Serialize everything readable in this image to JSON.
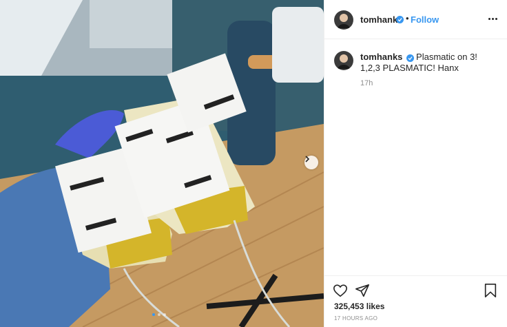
{
  "post": {
    "photo": {
      "image_icon": "photo-of-plasma-bags",
      "carousel_next_icon": "chevron-right-icon",
      "carousel_dots": 3,
      "carousel_active_index": 0
    },
    "header": {
      "username": "tomhanks",
      "verified_icon": "verified-badge-icon",
      "separator": "•",
      "follow_label": "Follow",
      "more_icon": "more-options-icon"
    },
    "caption": {
      "username": "tomhanks",
      "text": "Plasmatic on 3! 1,2,3 PLASMATIC! Hanx",
      "time": "17h"
    },
    "actions": {
      "like_icon": "heart-icon",
      "share_icon": "share-icon",
      "save_icon": "bookmark-icon",
      "likes_count": "325,453",
      "likes_label": "likes",
      "date": "17 HOURS AGO"
    },
    "colors": {
      "accent": "#3897f0",
      "text": "#262626",
      "muted": "#8e8e8e",
      "border": "#efefef"
    }
  }
}
